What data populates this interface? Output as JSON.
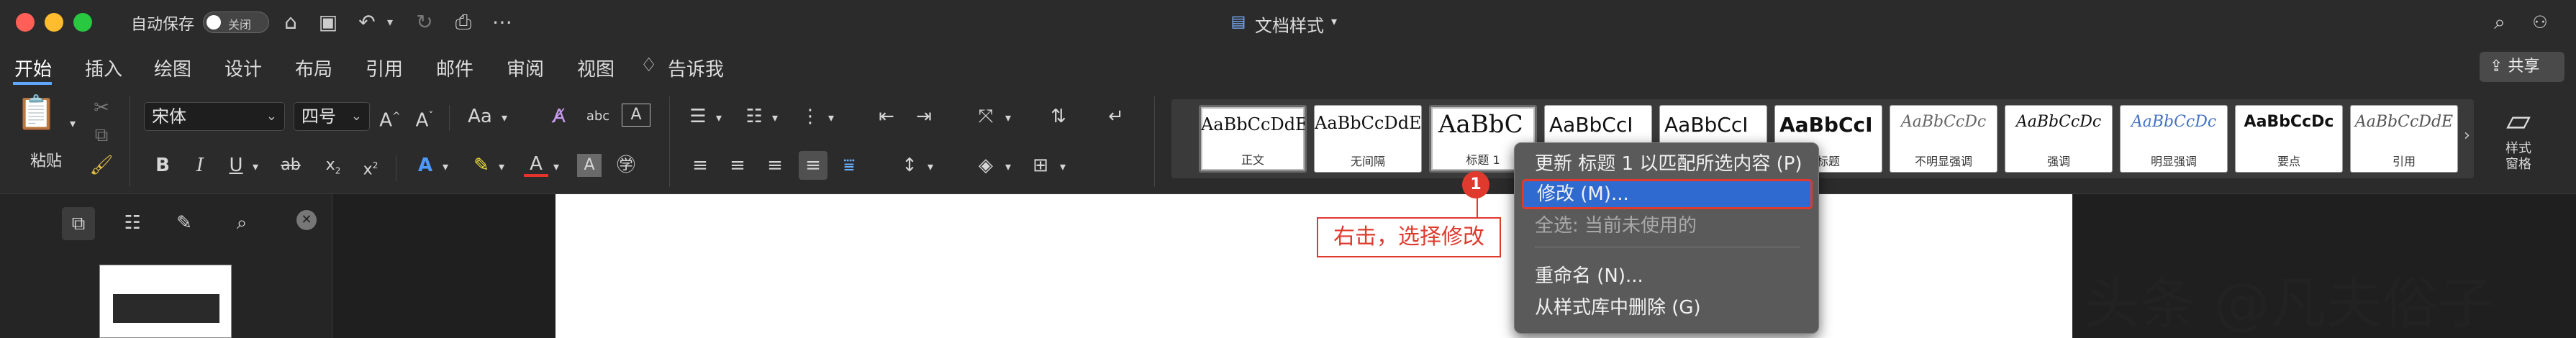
{
  "titlebar": {
    "autosave_label": "自动保存",
    "autosave_state": "关闭",
    "doc_title": "文档样式",
    "traffic_colors": [
      "#ff5f57",
      "#febc2e",
      "#28c840"
    ]
  },
  "tabs": [
    "开始",
    "插入",
    "绘图",
    "设计",
    "布局",
    "引用",
    "邮件",
    "审阅",
    "视图",
    "告诉我"
  ],
  "share_label": "共享",
  "ribbon": {
    "paste_label": "粘贴",
    "font_name": "宋体",
    "font_size": "四号",
    "case_label": "Aa",
    "style_pane_label": "样式\n窗格"
  },
  "styles": [
    {
      "sample": "AaBbCcDdE",
      "caption": "正文"
    },
    {
      "sample": "AaBbCcDdE",
      "caption": "无间隔"
    },
    {
      "sample": "AaBbC",
      "caption": "标题 1"
    },
    {
      "sample": "AaBbCcI",
      "caption": ""
    },
    {
      "sample": "AaBbCcI",
      "caption": ""
    },
    {
      "sample": "AaBbCcI",
      "caption": "标题"
    },
    {
      "sample": "AaBbCcDc",
      "caption": "不明显强调"
    },
    {
      "sample": "AaBbCcDc",
      "caption": "强调"
    },
    {
      "sample": "AaBbCcDc",
      "caption": "明显强调"
    },
    {
      "sample": "AaBbCcDc",
      "caption": "要点"
    },
    {
      "sample": "AaBbCcDdE",
      "caption": "引用"
    }
  ],
  "context_menu": {
    "update": "更新 标题 1 以匹配所选内容 (P)",
    "modify": "修改 (M)...",
    "select_all": "全选: 当前未使用的",
    "rename": "重命名 (N)...",
    "delete": "从样式库中删除 (G)"
  },
  "annotation": {
    "badge": "1",
    "text": "右击，选择修改",
    "color": "#e03a2e"
  },
  "watermark": "头条 @凡夫俗子"
}
